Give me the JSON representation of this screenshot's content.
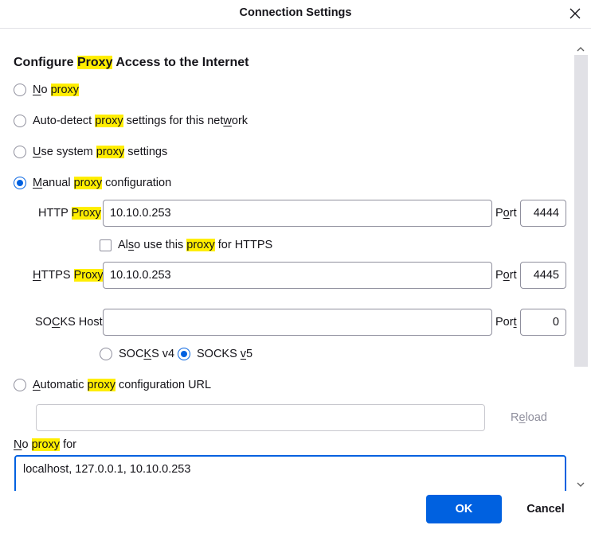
{
  "dialog": {
    "title": "Connection Settings"
  },
  "heading": {
    "pre": "Configure ",
    "hl": "Proxy",
    "post": " Access to the Internet"
  },
  "options": {
    "no_proxy": {
      "ul": "N",
      "pre": "o ",
      "hl": "proxy",
      "post": "",
      "checked": false
    },
    "auto_detect": {
      "pre": "Auto-detect ",
      "hl": "proxy",
      "mid": " settings for this net",
      "ul": "w",
      "post": "ork",
      "checked": false
    },
    "system": {
      "ul": "U",
      "pre": "se system ",
      "hl": "proxy",
      "post": " settings",
      "checked": false
    },
    "manual": {
      "ul": "M",
      "pre": "anual ",
      "hl": "proxy",
      "post": " configuration",
      "checked": true
    },
    "auto_url": {
      "ul": "A",
      "pre": "utomatic ",
      "hl": "proxy",
      "post": " configuration URL",
      "checked": false
    }
  },
  "http": {
    "label_pre": "HTTP ",
    "label_hl": "Proxy",
    "value": "10.10.0.253",
    "port_label_pre": "P",
    "port_label_ul": "o",
    "port_label_post": "rt",
    "port": "4444"
  },
  "also_https": {
    "pre": "Al",
    "ul": "s",
    "mid": "o use this ",
    "hl": "proxy",
    "post": " for HTTPS",
    "checked": false
  },
  "https": {
    "label_ul": "H",
    "label_pre": "TTPS ",
    "label_hl": "Proxy",
    "value": "10.10.0.253",
    "port_label_pre": "P",
    "port_label_ul": "o",
    "port_label_post": "rt",
    "port": "4445"
  },
  "socks": {
    "label_pre": "SO",
    "label_ul": "C",
    "label_post": "KS Host",
    "value": "",
    "port_label_pre": "Por",
    "port_label_ul": "t",
    "port_label_post": "",
    "port": "0",
    "v4": {
      "pre": "SOC",
      "ul": "K",
      "post": "S v4",
      "checked": false
    },
    "v5": {
      "pre": "SOCKS ",
      "ul": "v",
      "post": "5",
      "checked": true
    }
  },
  "auto_url_field": {
    "value": "",
    "reload_pre": "R",
    "reload_ul": "e",
    "reload_post": "load"
  },
  "no_proxy_for": {
    "ul": "N",
    "pre": "o ",
    "hl": "proxy",
    "post": " for",
    "value": "localhost, 127.0.0.1, 10.10.0.253"
  },
  "buttons": {
    "ok": "OK",
    "cancel": "Cancel"
  },
  "colors": {
    "accent": "#0061e0",
    "highlight": "#ffee00"
  }
}
